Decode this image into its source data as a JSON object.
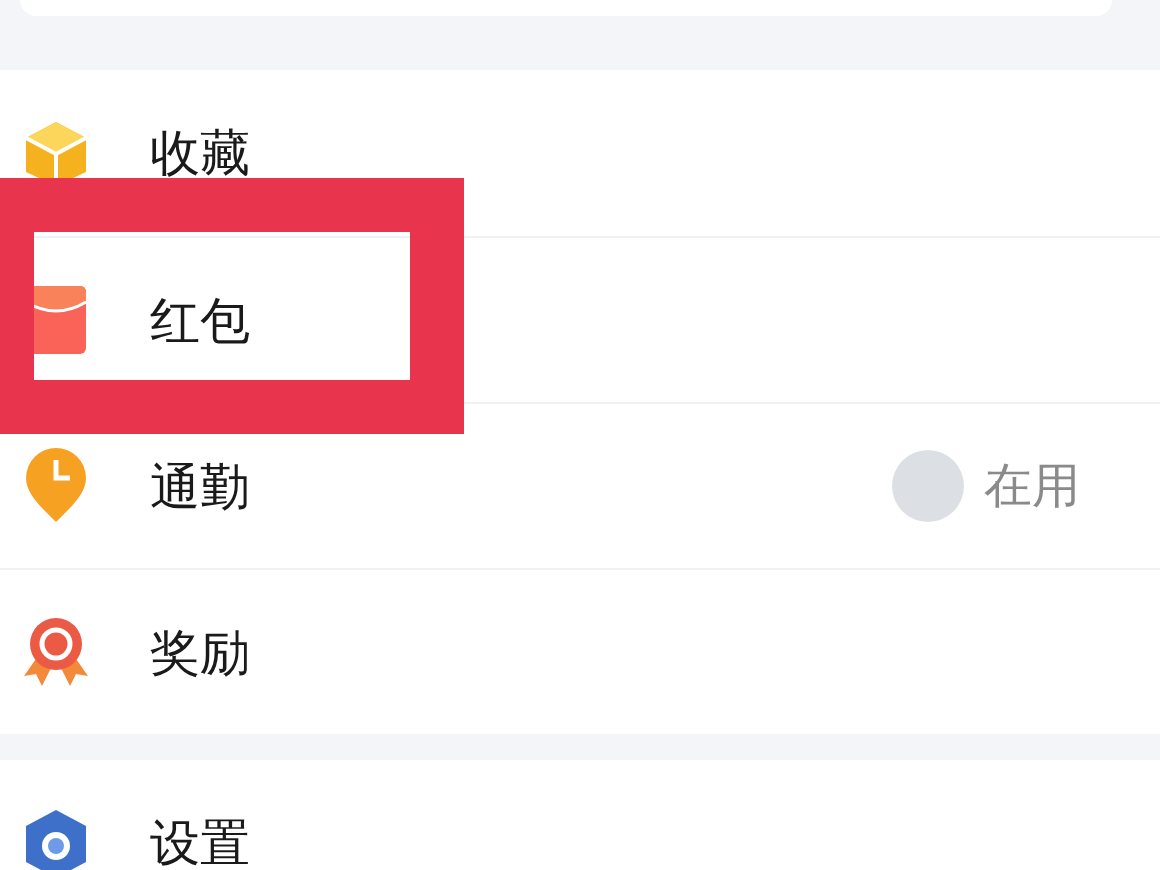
{
  "sections": [
    {
      "items": [
        {
          "label": "收藏",
          "highlighted": false
        },
        {
          "label": "红包",
          "highlighted": true
        },
        {
          "label": "通勤",
          "highlighted": false,
          "status": "在用",
          "avatar": true
        },
        {
          "label": "奖励",
          "highlighted": false
        }
      ]
    },
    {
      "items": [
        {
          "label": "设置",
          "highlighted": false
        }
      ]
    }
  ]
}
